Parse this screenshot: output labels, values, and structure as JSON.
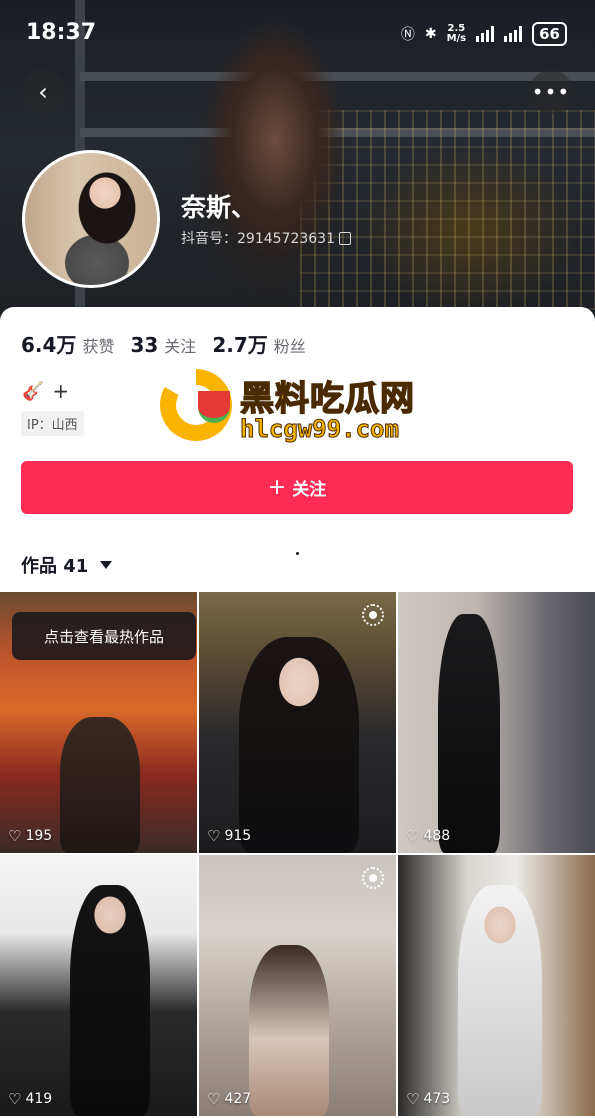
{
  "status_bar": {
    "time": "18:37",
    "net_speed_value": "2.5",
    "net_speed_unit": "M/s",
    "battery": "66"
  },
  "profile": {
    "nickname": "奈斯、",
    "account_id": "抖音号：29145723631",
    "stats": [
      {
        "value": "6.4万",
        "label": "获赞"
      },
      {
        "value": "33",
        "label": "关注"
      },
      {
        "value": "2.7万",
        "label": "粉丝"
      }
    ],
    "tag_plus": "+",
    "ip_location": "IP：山西",
    "follow_label": "关注",
    "follow_plus": "+"
  },
  "watermark": {
    "title": "黑料吃瓜网",
    "url": "hlcgw99.com"
  },
  "works": {
    "tab_label": "作品 41",
    "hint": "点击查看最热作品",
    "items": [
      {
        "likes": "195"
      },
      {
        "likes": "915"
      },
      {
        "likes": "488"
      },
      {
        "likes": "419"
      },
      {
        "likes": "427"
      },
      {
        "likes": "473"
      }
    ]
  },
  "colors": {
    "accent": "#fe2c55",
    "watermark_yellow": "#f5b300"
  },
  "icons": [
    "back-icon",
    "more-icon",
    "copy-icon",
    "guitar-icon",
    "chevron-down-icon",
    "heart-icon",
    "live-photo-icon"
  ]
}
